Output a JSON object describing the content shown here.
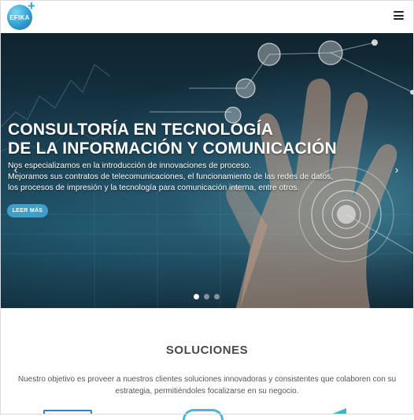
{
  "header": {
    "logo_text": "EFIKA",
    "logo_plus": "+",
    "menu_icon": "hamburger-menu-icon"
  },
  "hero": {
    "title_lines": [
      "CONSULTORÍA EN TECNOLOGÍA",
      "DE LA INFORMACIÓN Y COMUNICACIÓN"
    ],
    "description_lines": [
      "Nos especializamos en la introducción de innovaciones de proceso.",
      "Mejoramos sus contratos de telecomunicaciones, el funcionamiento de las redes de datos,",
      "los procesos de impresión y la tecnología para comunicación interna, entre otros."
    ],
    "button_label": "LEER MÁS",
    "prev_arrow": "‹",
    "next_arrow": "›",
    "slide_count": 3,
    "active_slide": 1
  },
  "soluciones": {
    "title": "SOLUCIONES",
    "text_lines": [
      "Nuestro objetivo es proveer a nuestros clientes soluciones innovadoras y consistentes que colaboren con su",
      "estrategia, permitiéndoles focalizarse en su negocio."
    ]
  },
  "colors": {
    "accent": "#3f9fcb",
    "hero_dark": "#10242f",
    "section_title": "#4a4a4a"
  }
}
